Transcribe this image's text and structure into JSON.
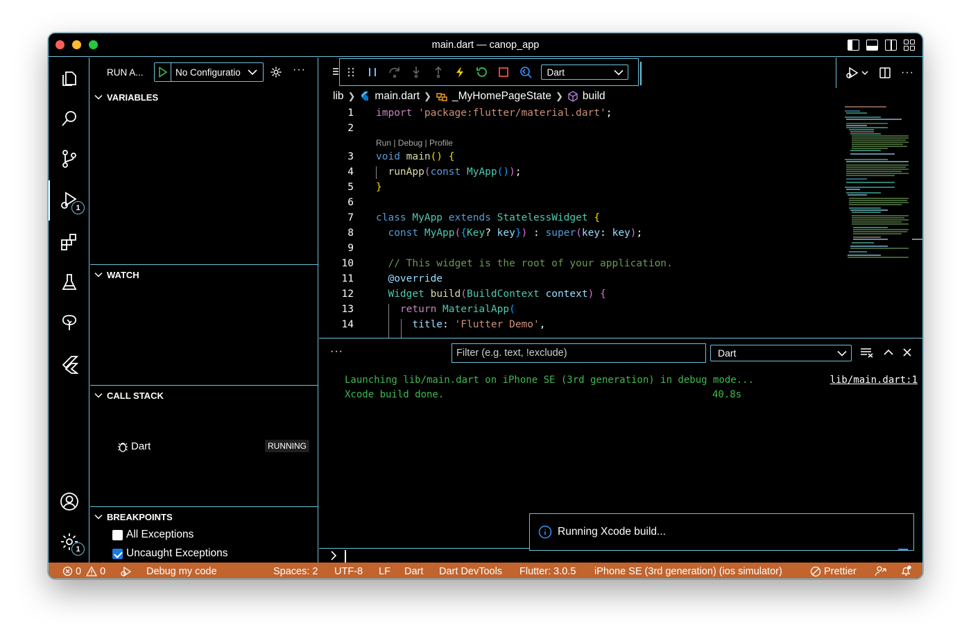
{
  "window": {
    "title": "main.dart — canop_app"
  },
  "sidebar": {
    "run_title": "RUN A...",
    "config_label": "No Configuratio",
    "sections": {
      "variables": "VARIABLES",
      "watch": "WATCH",
      "call_stack": "CALL STACK",
      "breakpoints": "BREAKPOINTS"
    },
    "call_stack_item": {
      "label": "Dart",
      "status": "RUNNING"
    },
    "breakpoints": [
      {
        "label": "All Exceptions",
        "checked": false
      },
      {
        "label": "Uncaught Exceptions",
        "checked": true
      }
    ]
  },
  "activity": {
    "debug_badge": "1",
    "settings_badge": "1"
  },
  "debug_toolbar": {
    "session": "Dart"
  },
  "breadcrumb": {
    "items": [
      "lib",
      "main.dart",
      "_MyHomePageState",
      "build"
    ]
  },
  "editor": {
    "codelens": "Run | Debug | Profile",
    "line_numbers": [
      "1",
      "2",
      "3",
      "4",
      "5",
      "6",
      "7",
      "8",
      "9",
      "10",
      "11",
      "12",
      "13",
      "14"
    ]
  },
  "panel": {
    "filter_placeholder": "Filter (e.g. text, !exclude)",
    "channel": "Dart",
    "output": [
      "Launching lib/main.dart on iPhone SE (3rd generation) in debug mode...",
      "Xcode build done."
    ],
    "output_link": "lib/main.dart:1",
    "output_time": "40.8s"
  },
  "notification": {
    "text": "Running Xcode build..."
  },
  "statusbar": {
    "errors": "0",
    "warnings": "0",
    "debug_label": "Debug my code",
    "spaces": "Spaces: 2",
    "encoding": "UTF-8",
    "eol": "LF",
    "language": "Dart",
    "devtools": "Dart DevTools",
    "flutter": "Flutter: 3.0.5",
    "device": "iPhone SE (3rd generation) (ios simulator)",
    "prettier": "Prettier"
  },
  "colors": {
    "border": "#6fc3df",
    "statusbar": "#c1642e",
    "output_text": "#3fb950",
    "keyword": "#569cd6",
    "string": "#ce9178"
  }
}
